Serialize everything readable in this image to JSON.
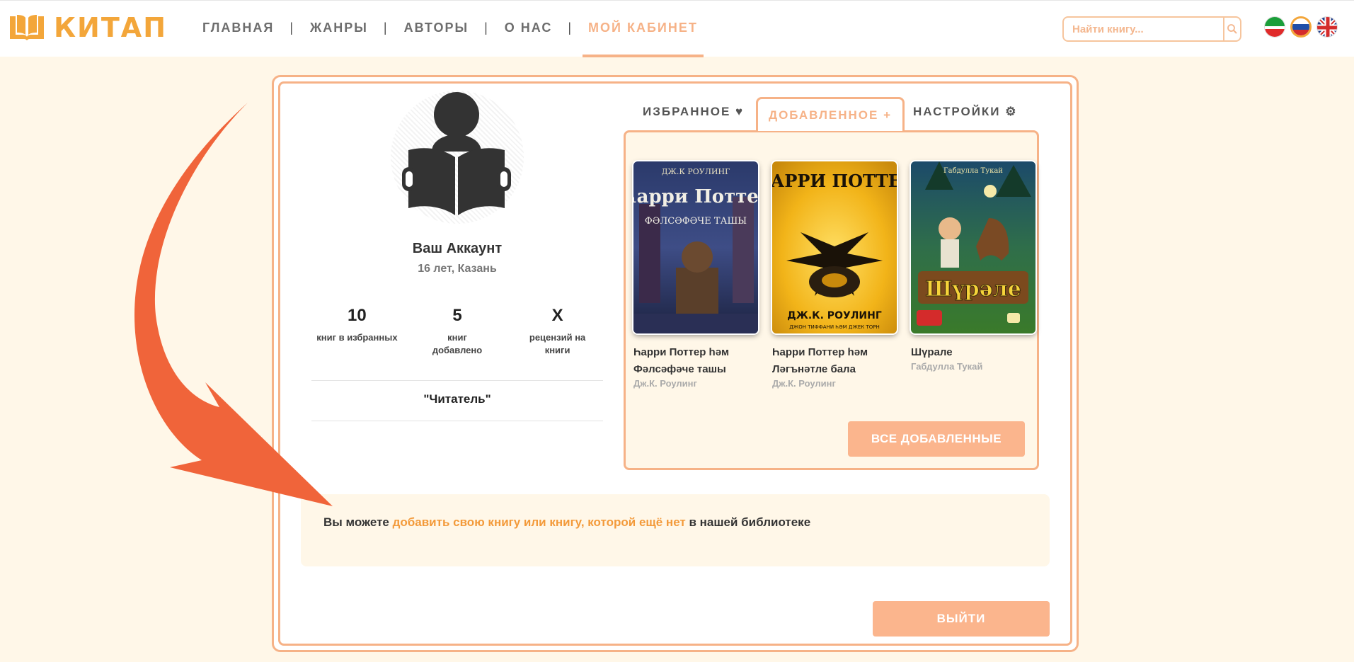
{
  "header": {
    "logo_text": "КИТАП",
    "nav": [
      {
        "label": "ГЛАВНАЯ",
        "active": false
      },
      {
        "label": "ЖАНРЫ",
        "active": false
      },
      {
        "label": "АВТОРЫ",
        "active": false
      },
      {
        "label": "О НАС",
        "active": false
      },
      {
        "label": "МОЙ КАБИНЕТ",
        "active": true
      }
    ],
    "separator": "|",
    "search_placeholder": "Найти книгу...",
    "languages": [
      "tatar-flag-icon",
      "russia-flag-icon",
      "uk-flag-icon"
    ]
  },
  "profile": {
    "name": "Ваш Аккаунт",
    "subtitle": "16 лет, Казань",
    "stats": [
      {
        "value": "10",
        "label": "книг в избранных"
      },
      {
        "value": "5",
        "label": "книг добавлено"
      },
      {
        "value": "X",
        "label": "рецензий на книги"
      }
    ],
    "rank": "\"Читатель\""
  },
  "tabs": {
    "favorites": "ИЗБРАННОЕ ♥",
    "added": "ДОБАВЛЕННОЕ +",
    "settings": "НАСТРОЙКИ ⚙"
  },
  "books": [
    {
      "title": "Һарри Поттер һәм Фәлсәфәче ташы",
      "author": "Дж.К. Роулинг",
      "cover_text_top": "ДЖ.К РОУЛИНГ",
      "cover_text_main": "Һарри Поттер",
      "cover_text_sub": "ФӘЛСӘФӘЧЕ ТАШЫ"
    },
    {
      "title": "Һарри Поттер һәм Ләгънәтле бала",
      "author": "Дж.К. Роулинг",
      "cover_text_top": "ҺАРРИ ПОТТЕР",
      "cover_text_main": "ДЖ.К. РОУЛИНГ",
      "cover_text_sub": "ДЖОН ТИФФАНИ ҺӘМ ДЖЕК ТОРН"
    },
    {
      "title": "Шүрале",
      "author": "Габдулла Тукай",
      "cover_text_top": "Габдулла Тукай",
      "cover_text_main": "Шүрәле",
      "cover_text_sub": ""
    }
  ],
  "buttons": {
    "all_added": "ВСЕ ДОБАВЛЕННЫЕ",
    "logout": "ВЫЙТИ"
  },
  "info": {
    "prefix": "Вы можете ",
    "link": "добавить свою книгу или книгу, которой ещё нет",
    "suffix": " в нашей библиотеке"
  },
  "colors": {
    "accent": "#f6b287",
    "logo": "#f3a63a",
    "link": "#f39a3a",
    "arrow": "#f0643a",
    "page_bg": "#fff7e8"
  }
}
